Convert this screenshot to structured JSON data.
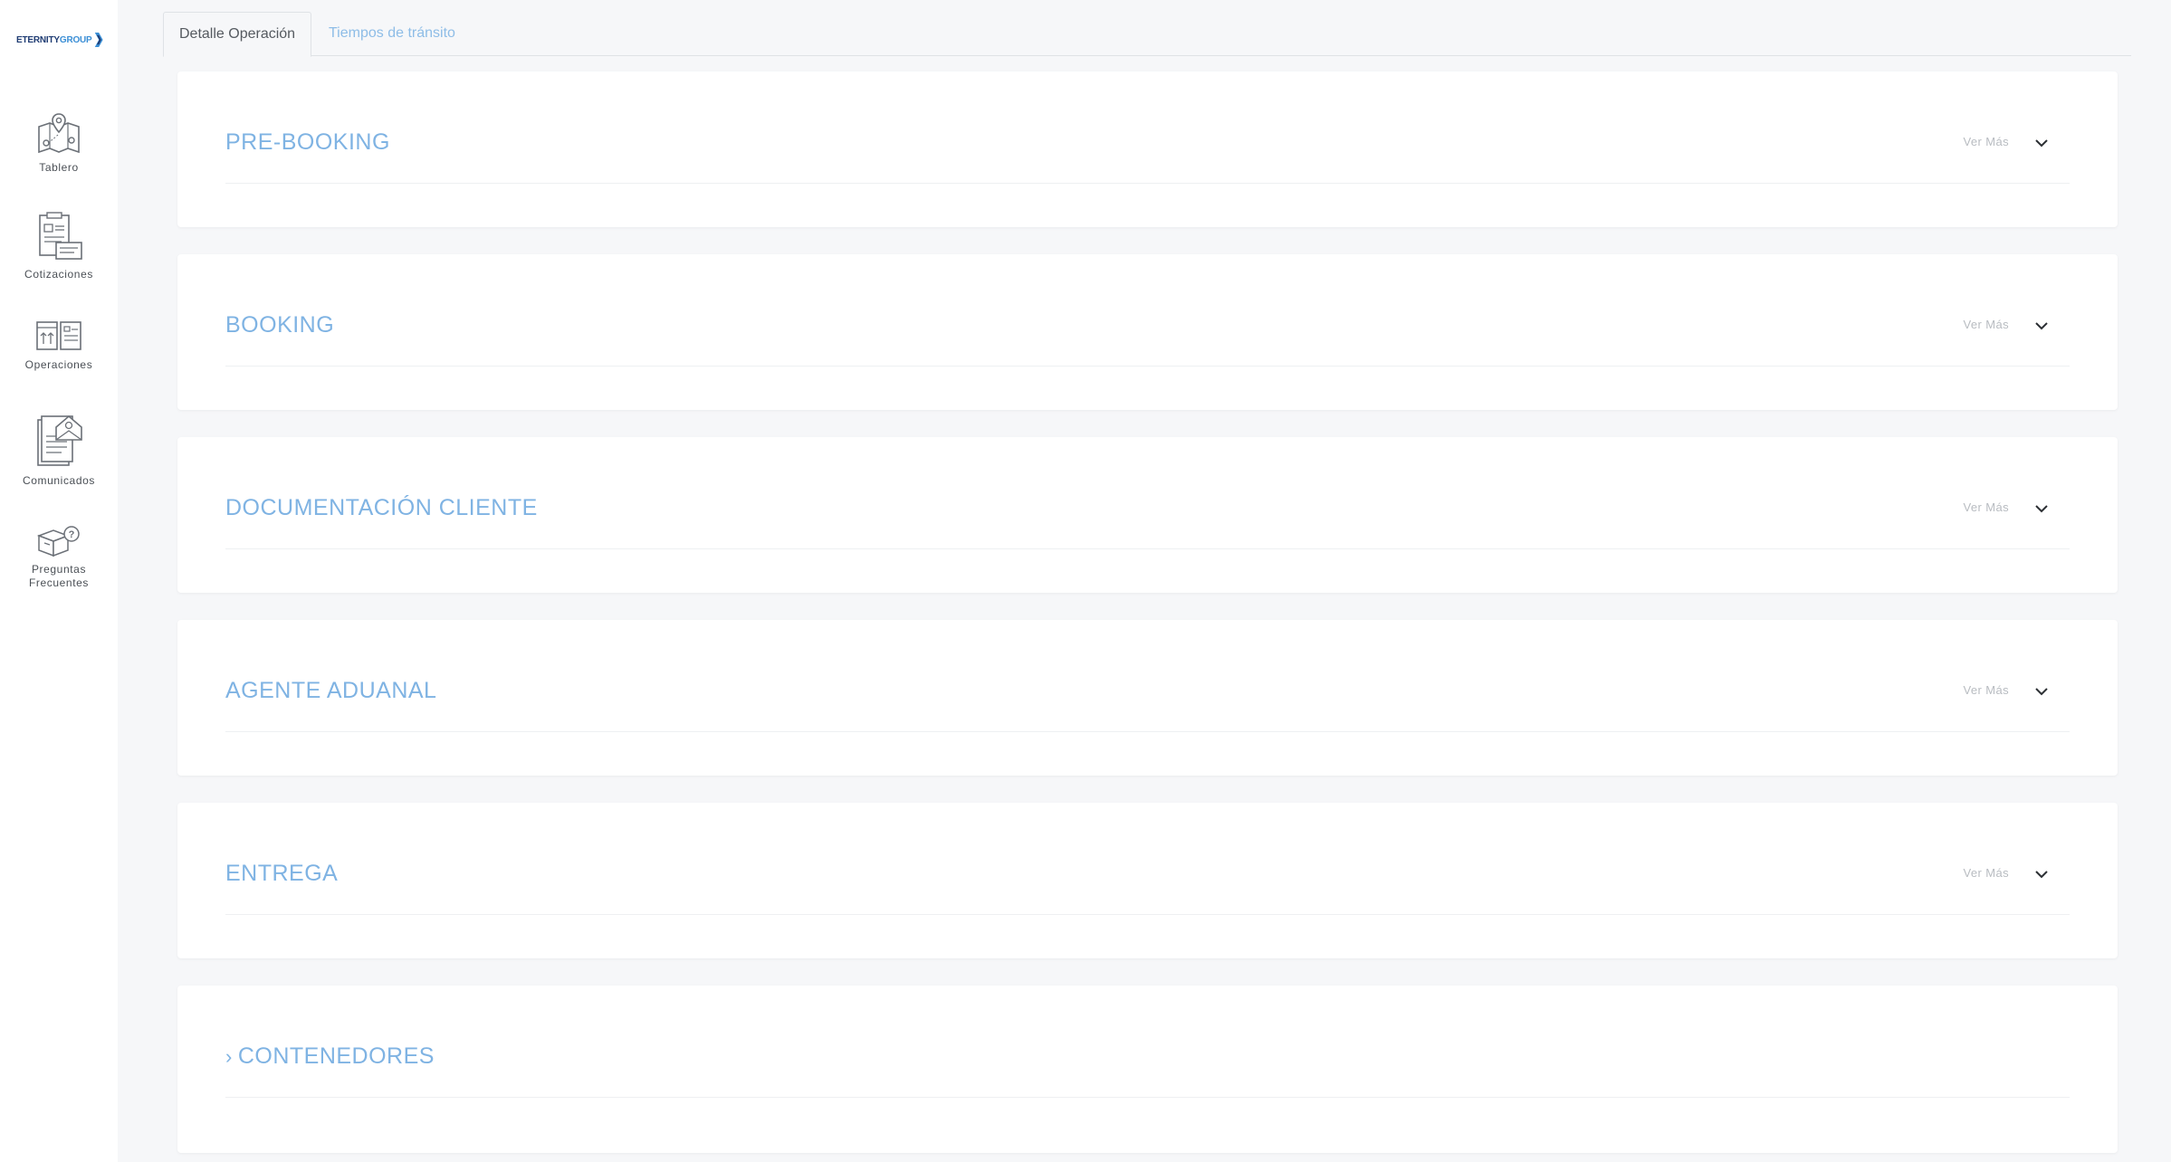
{
  "brand": {
    "part1": "ETERNITY",
    "part2": "GROUP"
  },
  "sidebar": {
    "items": [
      {
        "label": "Tablero",
        "icon": "map-board-icon"
      },
      {
        "label": "Cotizaciones",
        "icon": "quotation-icon"
      },
      {
        "label": "Operaciones",
        "icon": "operations-boxes-icon"
      },
      {
        "label": "Comunicados",
        "icon": "envelope-document-icon"
      },
      {
        "label_line1": "Preguntas",
        "label_line2": "Frecuentes",
        "icon": "faq-box-icon"
      }
    ]
  },
  "tabs": [
    {
      "label": "Detalle Operación",
      "active": true
    },
    {
      "label": "Tiempos de tránsito",
      "active": false
    }
  ],
  "panels": [
    {
      "title": "PRE-BOOKING",
      "action": "Ver Más"
    },
    {
      "title": "BOOKING",
      "action": "Ver Más"
    },
    {
      "title": "DOCUMENTACIÓN CLIENTE",
      "action": "Ver Más"
    },
    {
      "title": "AGENTE ADUANAL",
      "action": "Ver Más"
    },
    {
      "title": "ENTREGA",
      "action": "Ver Más"
    },
    {
      "title": "CONTENEDORES",
      "prefix": "›"
    }
  ],
  "colors": {
    "accent": "#7fb3e3",
    "brand_dark": "#1f3c73",
    "brand_light": "#3b8fd6",
    "background": "#f6f7f9"
  }
}
